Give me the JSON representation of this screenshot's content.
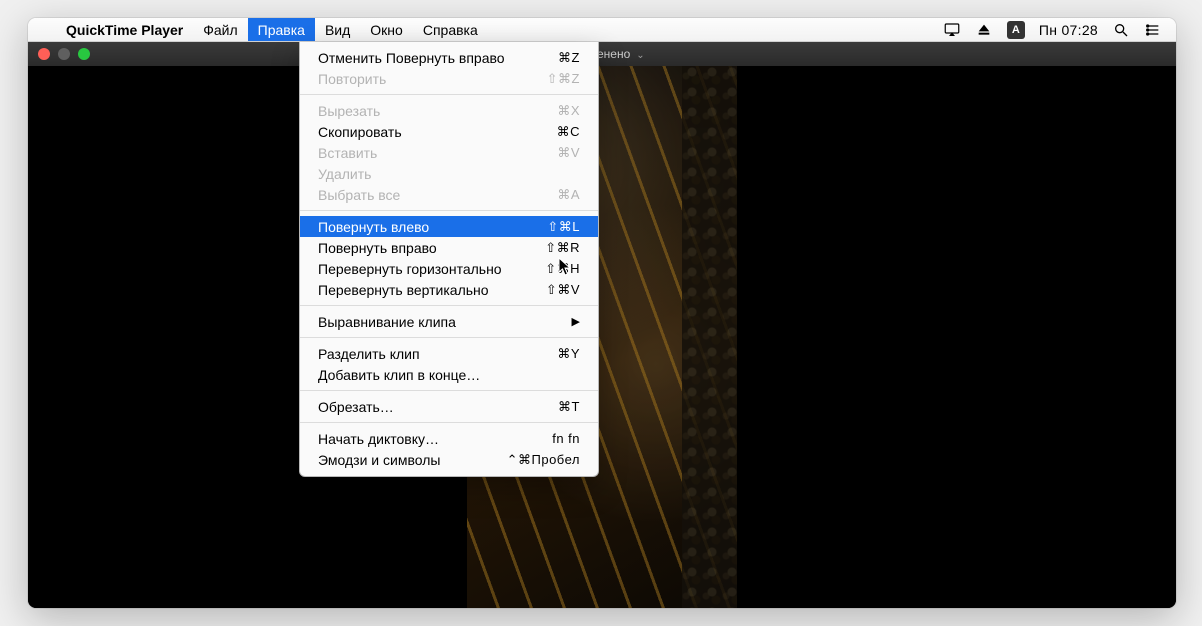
{
  "menubar": {
    "app_name": "QuickTime Player",
    "items": [
      {
        "label": "Файл",
        "open": false
      },
      {
        "label": "Правка",
        "open": true
      },
      {
        "label": "Вид",
        "open": false
      },
      {
        "label": "Окно",
        "open": false
      },
      {
        "label": "Справка",
        "open": false
      }
    ],
    "lang_badge": "A",
    "clock": "Пн 07:28"
  },
  "window": {
    "title_suffix": " — Изменено"
  },
  "dropdown": {
    "groups": [
      [
        {
          "label": "Отменить Повернуть вправо",
          "shortcut": "⌘Z",
          "enabled": true
        },
        {
          "label": "Повторить",
          "shortcut": "⇧⌘Z",
          "enabled": false
        }
      ],
      [
        {
          "label": "Вырезать",
          "shortcut": "⌘X",
          "enabled": false
        },
        {
          "label": "Скопировать",
          "shortcut": "⌘C",
          "enabled": true
        },
        {
          "label": "Вставить",
          "shortcut": "⌘V",
          "enabled": false
        },
        {
          "label": "Удалить",
          "shortcut": "",
          "enabled": false
        },
        {
          "label": "Выбрать все",
          "shortcut": "⌘A",
          "enabled": false
        }
      ],
      [
        {
          "label": "Повернуть влево",
          "shortcut": "⇧⌘L",
          "enabled": true,
          "highlight": true
        },
        {
          "label": "Повернуть вправо",
          "shortcut": "⇧⌘R",
          "enabled": true
        },
        {
          "label": "Перевернуть горизонтально",
          "shortcut": "⇧⌘H",
          "enabled": true
        },
        {
          "label": "Перевернуть вертикально",
          "shortcut": "⇧⌘V",
          "enabled": true
        }
      ],
      [
        {
          "label": "Выравнивание клипа",
          "shortcut": "",
          "enabled": true,
          "submenu": true
        }
      ],
      [
        {
          "label": "Разделить клип",
          "shortcut": "⌘Y",
          "enabled": true
        },
        {
          "label": "Добавить клип в конце…",
          "shortcut": "",
          "enabled": true
        }
      ],
      [
        {
          "label": "Обрезать…",
          "shortcut": "⌘T",
          "enabled": true
        }
      ],
      [
        {
          "label": "Начать диктовку…",
          "shortcut": "fn fn",
          "enabled": true
        },
        {
          "label": "Эмодзи и символы",
          "shortcut": "⌃⌘Пробел",
          "enabled": true
        }
      ]
    ]
  }
}
